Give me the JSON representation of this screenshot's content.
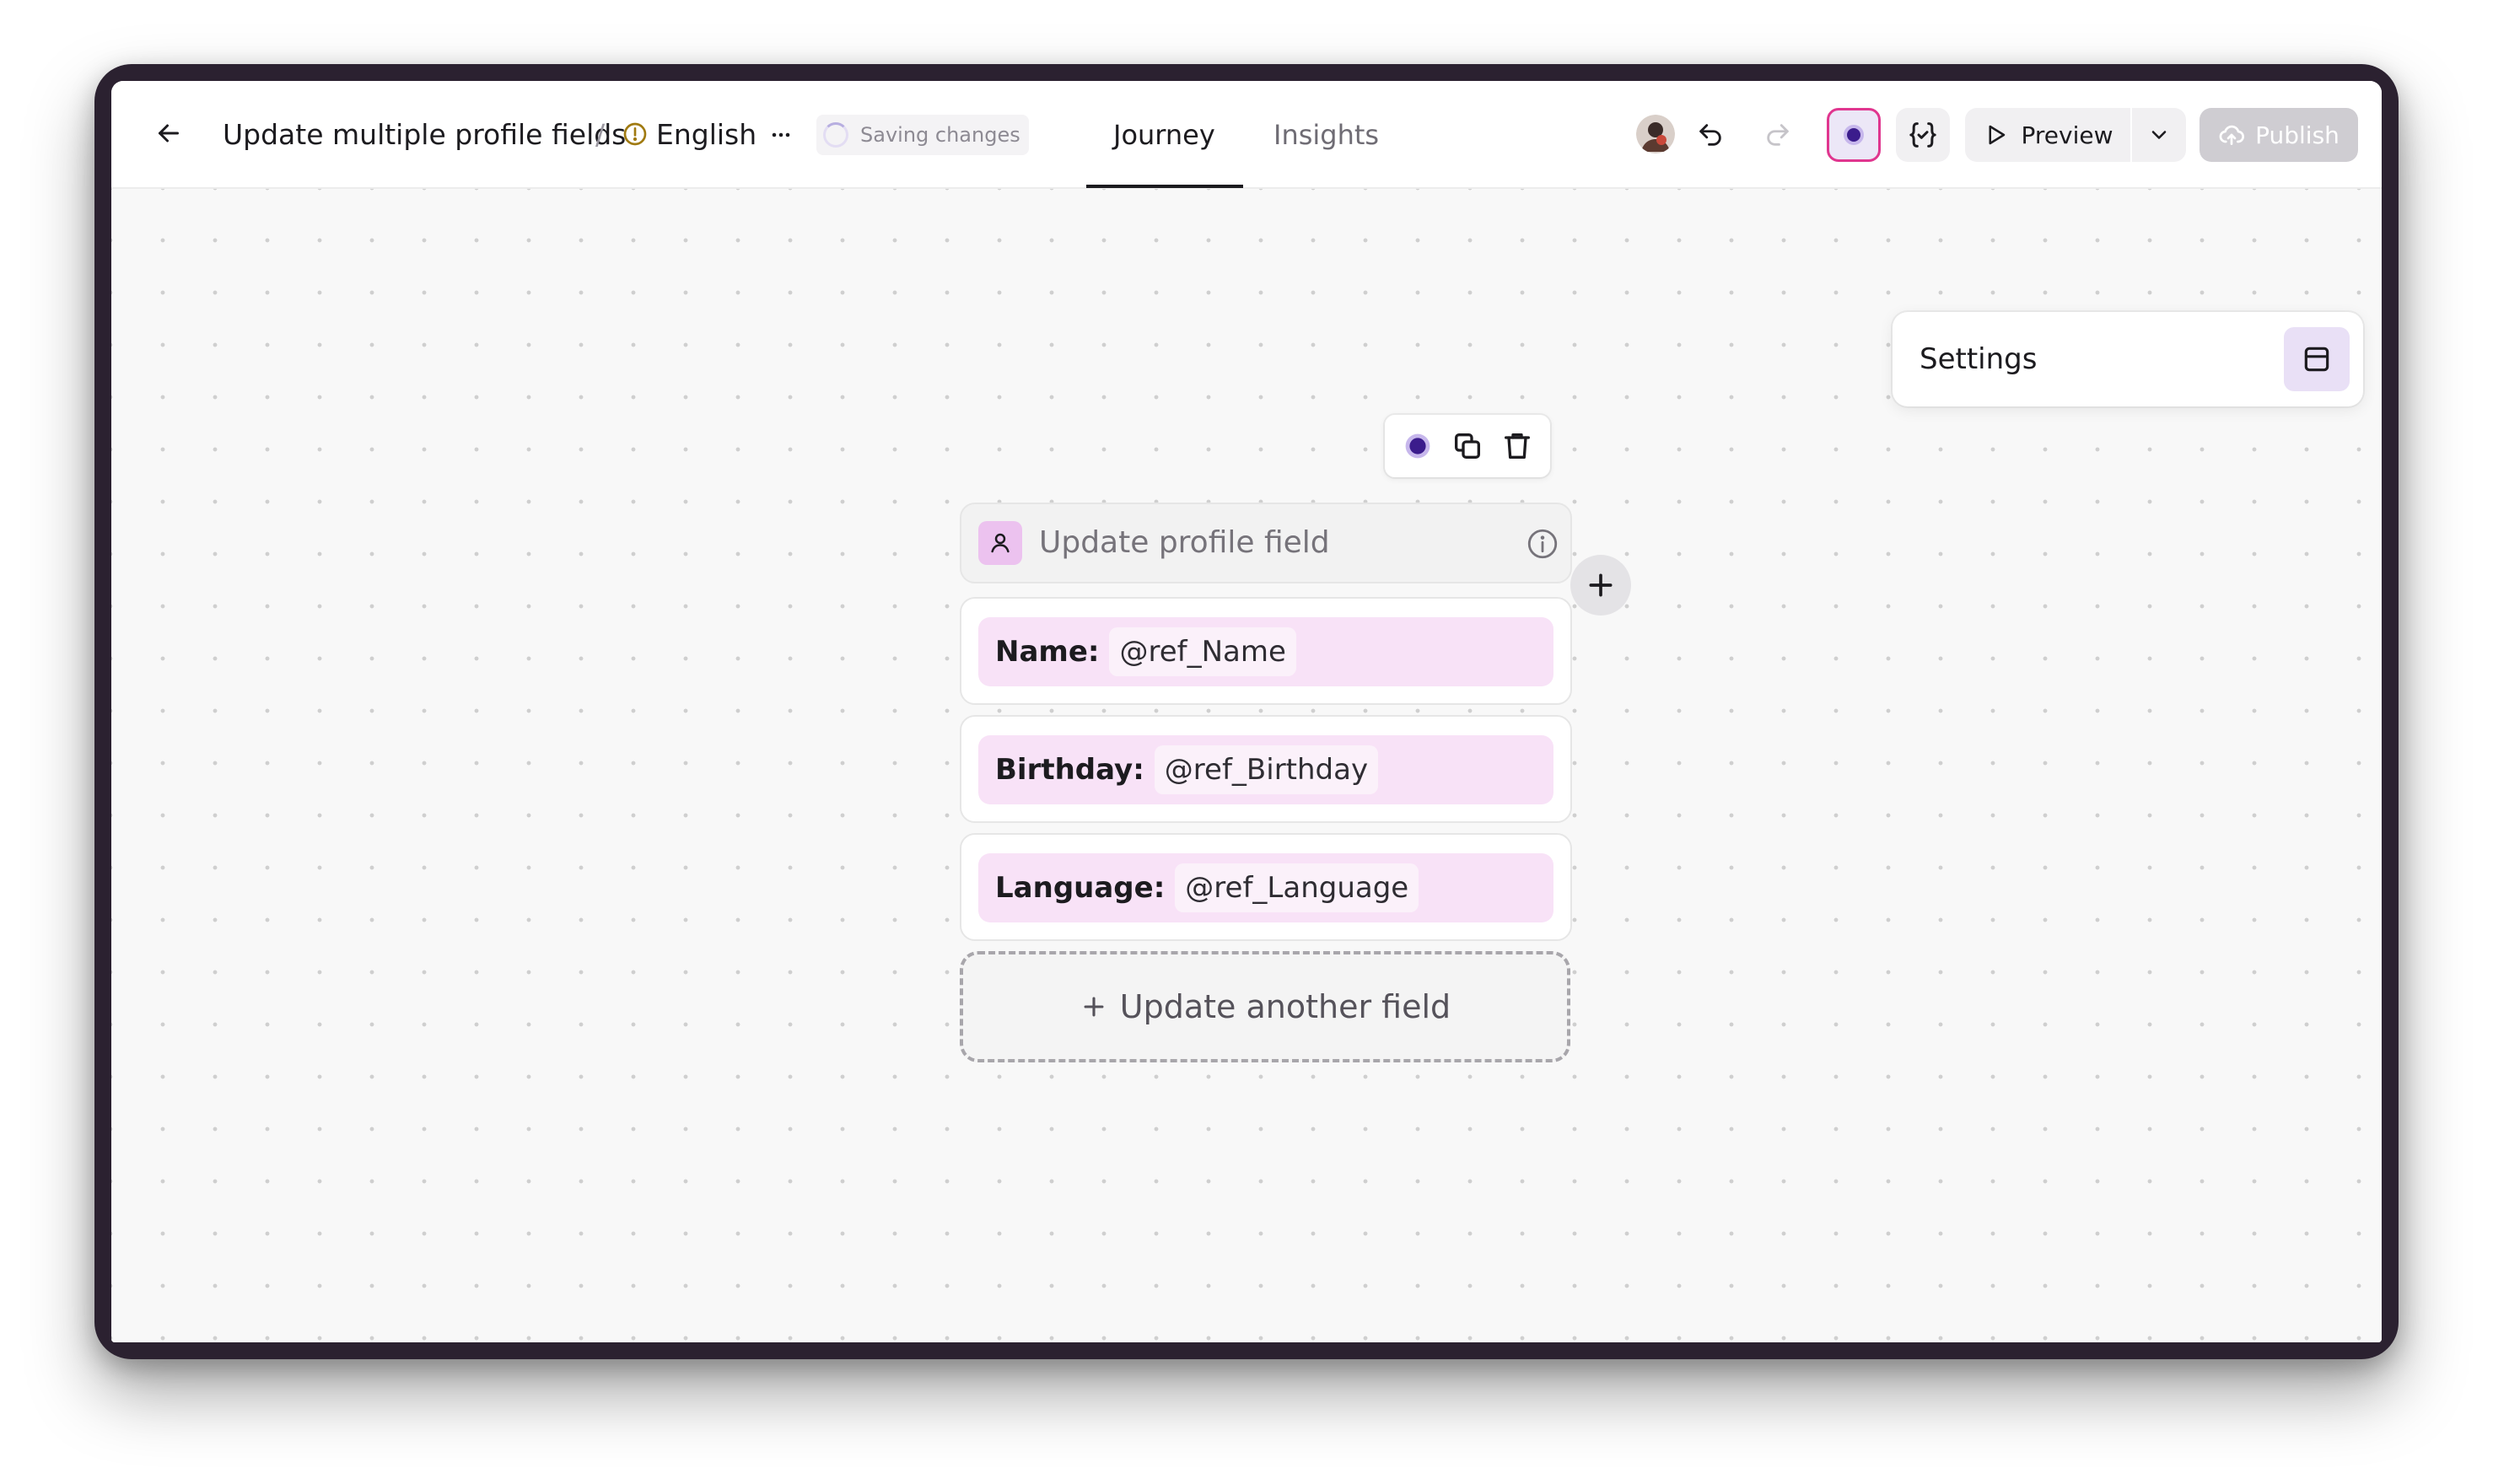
{
  "header": {
    "journey_title": "Update multiple profile fields",
    "separator": "/",
    "language": "English",
    "saving_status": "Saving changes",
    "tabs": [
      {
        "label": "Journey",
        "active": true
      },
      {
        "label": "Insights",
        "active": false
      }
    ],
    "preview_label": "Preview",
    "publish_label": "Publish",
    "accent_color": "#e0368f",
    "theme_color": "#3b1c8c"
  },
  "settings_panel": {
    "label": "Settings"
  },
  "node": {
    "title": "Update profile field",
    "fields": [
      {
        "label": "Name:",
        "value": "@ref_Name"
      },
      {
        "label": "Birthday:",
        "value": "@ref_Birthday"
      },
      {
        "label": "Language:",
        "value": "@ref_Language"
      }
    ],
    "add_field_label": "Update another field"
  },
  "icons": {
    "back": "arrow-left-icon",
    "warning": "warning-circle-icon",
    "more": "ellipsis-icon",
    "undo": "undo-icon",
    "redo": "redo-icon",
    "variables": "braces-icon",
    "play": "play-icon",
    "caret": "chevron-down-icon",
    "cloud": "cloud-upload-icon",
    "layout": "panel-icon",
    "duplicate": "copy-icon",
    "delete": "trash-icon",
    "user": "user-icon",
    "info": "info-icon",
    "plus": "plus-icon",
    "help": "question-icon"
  }
}
